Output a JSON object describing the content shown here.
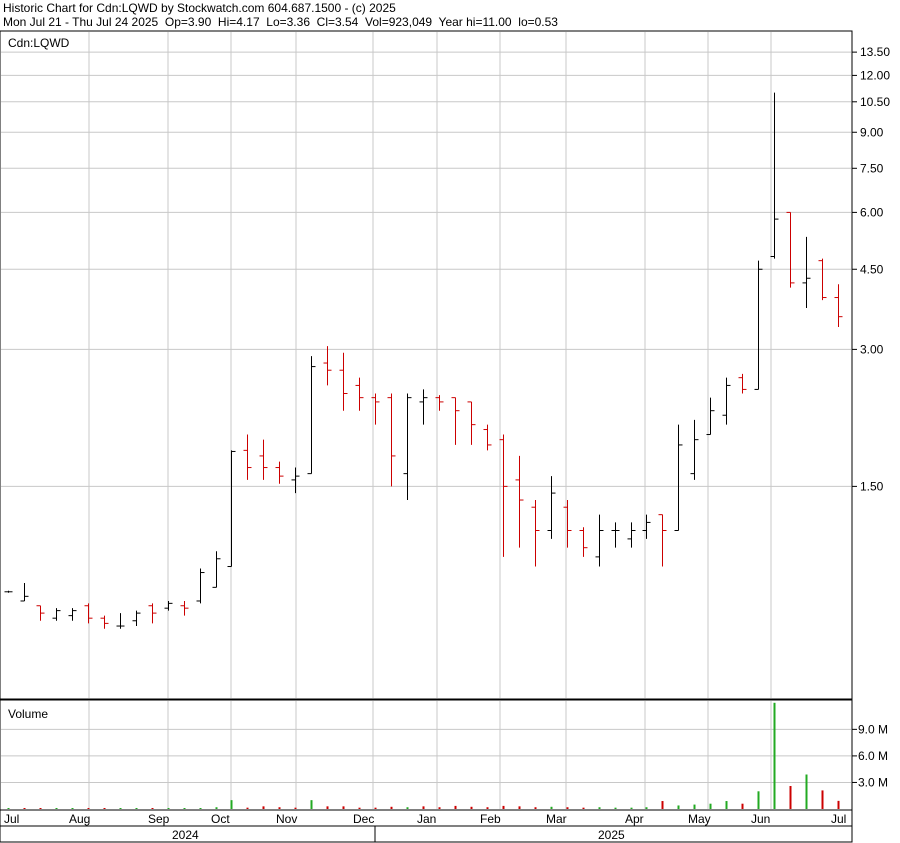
{
  "header": {
    "line1": "Historic Chart for Cdn:LQWD by Stockwatch.com 604.687.1500 - (c) 2025",
    "line2": "Mon Jul 21 - Thu Jul 24 2025  Op=3.90  Hi=4.17  Lo=3.36  Cl=3.54  Vol=923,049  Year hi=11.00  lo=0.53"
  },
  "colors": {
    "up": "#000000",
    "down": "#cc0000",
    "vol_up": "#22aa22",
    "vol_down": "#cc0000",
    "grid": "#c8c8c8"
  },
  "chart_data": [
    {
      "type": "ohlc",
      "title": "Cdn:LQWD",
      "scale": "log",
      "ylim": [
        0.53,
        14.5
      ],
      "y_ticks": [
        "13.50",
        "12.00",
        "10.50",
        "9.00",
        "7.50",
        "6.00",
        "4.50",
        "3.00",
        "1.50"
      ],
      "x_labels": [
        "Jul",
        "Aug",
        "Sep",
        "Oct",
        "Nov",
        "Dec",
        "Jan",
        "Feb",
        "Mar",
        "Apr",
        "May",
        "Jun",
        "Jul"
      ],
      "years": [
        "2024",
        "2025"
      ],
      "bars": [
        {
          "o": 0.88,
          "h": 0.88,
          "l": 0.88,
          "c": 0.88
        },
        {
          "o": 0.84,
          "h": 0.92,
          "l": 0.84,
          "c": 0.86
        },
        {
          "o": 0.82,
          "h": 0.82,
          "l": 0.76,
          "c": 0.79
        },
        {
          "o": 0.77,
          "h": 0.81,
          "l": 0.76,
          "c": 0.8
        },
        {
          "o": 0.78,
          "h": 0.81,
          "l": 0.76,
          "c": 0.8
        },
        {
          "o": 0.82,
          "h": 0.83,
          "l": 0.75,
          "c": 0.77
        },
        {
          "o": 0.77,
          "h": 0.78,
          "l": 0.73,
          "c": 0.75
        },
        {
          "o": 0.74,
          "h": 0.79,
          "l": 0.73,
          "c": 0.74
        },
        {
          "o": 0.76,
          "h": 0.8,
          "l": 0.74,
          "c": 0.79
        },
        {
          "o": 0.82,
          "h": 0.83,
          "l": 0.75,
          "c": 0.79
        },
        {
          "o": 0.81,
          "h": 0.84,
          "l": 0.8,
          "c": 0.83
        },
        {
          "o": 0.82,
          "h": 0.84,
          "l": 0.78,
          "c": 0.81
        },
        {
          "o": 0.84,
          "h": 0.99,
          "l": 0.83,
          "c": 0.97
        },
        {
          "o": 0.9,
          "h": 1.08,
          "l": 0.9,
          "c": 1.04
        },
        {
          "o": 1.0,
          "h": 1.8,
          "l": 1.0,
          "c": 1.79
        },
        {
          "o": 1.8,
          "h": 1.95,
          "l": 1.55,
          "c": 1.65
        },
        {
          "o": 1.75,
          "h": 1.9,
          "l": 1.55,
          "c": 1.65
        },
        {
          "o": 1.65,
          "h": 1.7,
          "l": 1.52,
          "c": 1.58
        },
        {
          "o": 1.55,
          "h": 1.65,
          "l": 1.45,
          "c": 1.58
        },
        {
          "o": 1.6,
          "h": 2.9,
          "l": 1.6,
          "c": 2.75
        },
        {
          "o": 2.8,
          "h": 3.05,
          "l": 2.5,
          "c": 2.7
        },
        {
          "o": 2.7,
          "h": 2.95,
          "l": 2.2,
          "c": 2.4
        },
        {
          "o": 2.5,
          "h": 2.6,
          "l": 2.2,
          "c": 2.35
        },
        {
          "o": 2.35,
          "h": 2.4,
          "l": 2.05,
          "c": 2.3
        },
        {
          "o": 2.35,
          "h": 2.4,
          "l": 1.5,
          "c": 1.75
        },
        {
          "o": 1.6,
          "h": 2.4,
          "l": 1.4,
          "c": 2.35
        },
        {
          "o": 2.3,
          "h": 2.45,
          "l": 2.05,
          "c": 2.35
        },
        {
          "o": 2.35,
          "h": 2.38,
          "l": 2.2,
          "c": 2.3
        },
        {
          "o": 2.35,
          "h": 2.35,
          "l": 1.85,
          "c": 2.2
        },
        {
          "o": 2.3,
          "h": 2.3,
          "l": 1.85,
          "c": 2.05
        },
        {
          "o": 2.0,
          "h": 2.05,
          "l": 1.8,
          "c": 1.85
        },
        {
          "o": 1.9,
          "h": 1.95,
          "l": 1.05,
          "c": 1.5
        },
        {
          "o": 1.55,
          "h": 1.75,
          "l": 1.1,
          "c": 1.4
        },
        {
          "o": 1.35,
          "h": 1.4,
          "l": 1.0,
          "c": 1.2
        },
        {
          "o": 1.2,
          "h": 1.58,
          "l": 1.15,
          "c": 1.45
        },
        {
          "o": 1.35,
          "h": 1.4,
          "l": 1.1,
          "c": 1.2
        },
        {
          "o": 1.2,
          "h": 1.22,
          "l": 1.05,
          "c": 1.1
        },
        {
          "o": 1.05,
          "h": 1.3,
          "l": 1.0,
          "c": 1.2
        },
        {
          "o": 1.2,
          "h": 1.25,
          "l": 1.1,
          "c": 1.2
        },
        {
          "o": 1.15,
          "h": 1.25,
          "l": 1.1,
          "c": 1.2
        },
        {
          "o": 1.2,
          "h": 1.3,
          "l": 1.15,
          "c": 1.25
        },
        {
          "o": 1.3,
          "h": 1.3,
          "l": 1.0,
          "c": 1.2
        },
        {
          "o": 1.2,
          "h": 2.05,
          "l": 1.2,
          "c": 1.85
        },
        {
          "o": 1.6,
          "h": 2.1,
          "l": 1.55,
          "c": 1.9
        },
        {
          "o": 1.95,
          "h": 2.35,
          "l": 1.95,
          "c": 2.2
        },
        {
          "o": 2.15,
          "h": 2.6,
          "l": 2.05,
          "c": 2.5
        },
        {
          "o": 2.6,
          "h": 2.65,
          "l": 2.4,
          "c": 2.45
        },
        {
          "o": 2.45,
          "h": 4.7,
          "l": 2.45,
          "c": 4.5
        },
        {
          "o": 4.8,
          "h": 11.0,
          "l": 4.75,
          "c": 5.8
        },
        {
          "o": 6.0,
          "h": 6.0,
          "l": 4.1,
          "c": 4.2
        },
        {
          "o": 4.2,
          "h": 5.3,
          "l": 3.7,
          "c": 4.3
        },
        {
          "o": 4.7,
          "h": 4.75,
          "l": 3.85,
          "c": 3.9
        },
        {
          "o": 3.9,
          "h": 4.17,
          "l": 3.36,
          "c": 3.54
        }
      ]
    },
    {
      "type": "bar",
      "title": "Volume",
      "ylim": [
        0,
        12
      ],
      "y_ticks": [
        "9.0 M",
        "6.0 M",
        "3.0 M"
      ],
      "values": [
        0.05,
        0.05,
        0.05,
        0.05,
        0.05,
        0.05,
        0.05,
        0.05,
        0.05,
        0.05,
        0.05,
        0.05,
        0.1,
        0.2,
        1.0,
        0.15,
        0.3,
        0.2,
        0.15,
        1.0,
        0.3,
        0.3,
        0.15,
        0.15,
        0.25,
        0.2,
        0.3,
        0.2,
        0.35,
        0.25,
        0.2,
        0.35,
        0.3,
        0.2,
        0.25,
        0.2,
        0.15,
        0.2,
        0.15,
        0.15,
        0.2,
        0.9,
        0.4,
        0.5,
        0.6,
        0.9,
        0.6,
        2.0,
        12.0,
        2.6,
        3.9,
        2.1,
        0.92
      ],
      "up": [
        1,
        0,
        0,
        1,
        1,
        0,
        0,
        1,
        1,
        0,
        1,
        1,
        1,
        1,
        1,
        0,
        0,
        0,
        0,
        1,
        0,
        0,
        0,
        0,
        0,
        1,
        0,
        0,
        0,
        0,
        0,
        0,
        0,
        0,
        1,
        0,
        0,
        1,
        1,
        1,
        1,
        0,
        1,
        1,
        1,
        1,
        0,
        1,
        1,
        0,
        1,
        0,
        0
      ]
    }
  ]
}
